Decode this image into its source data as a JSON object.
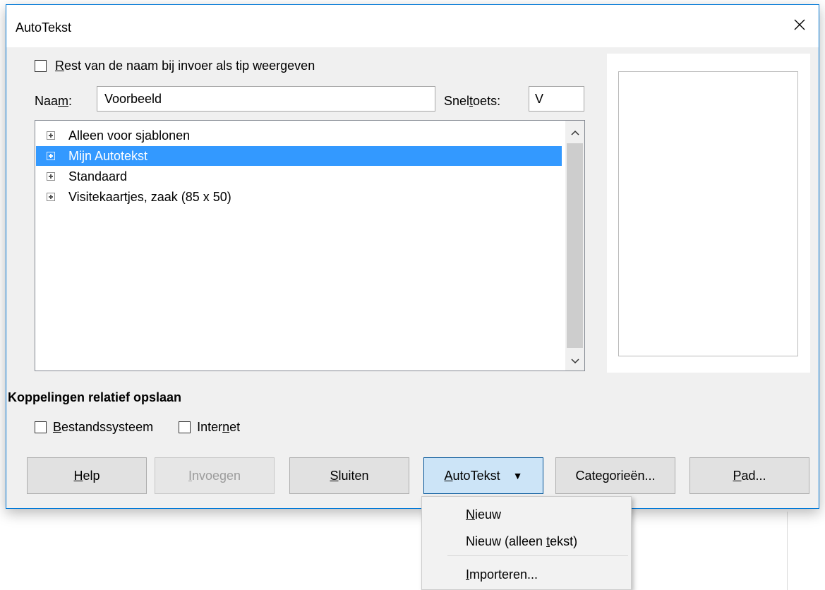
{
  "dialog": {
    "title": "AutoTekst",
    "close_glyph": "✕",
    "tip_checkbox": {
      "label_prefix": "",
      "label_mnemonic": "R",
      "label_rest": "est van de naam bij invoer als tip weergeven",
      "checked": false
    },
    "name_field": {
      "label_prefix": "Naa",
      "label_mnemonic": "m",
      "label_rest": ":",
      "value": "Voorbeeld"
    },
    "shortcut_field": {
      "label_prefix": "Snel",
      "label_mnemonic": "t",
      "label_rest": "oets:",
      "value": "V"
    },
    "categories": [
      {
        "label": "Alleen voor sjablonen",
        "selected": false
      },
      {
        "label": "Mijn Autotekst",
        "selected": true
      },
      {
        "label": "Standaard",
        "selected": false
      },
      {
        "label": "Visitekaartjes, zaak (85 x 50)",
        "selected": false
      }
    ],
    "links_section": {
      "heading": "Koppelingen relatief opslaan",
      "filesystem": {
        "label_prefix": "",
        "label_mnemonic": "B",
        "label_rest": "estandssysteem",
        "checked": false
      },
      "internet": {
        "label_prefix": "Inter",
        "label_mnemonic": "n",
        "label_rest": "et",
        "checked": false
      }
    },
    "buttons": {
      "help": {
        "mnemonic": "H",
        "rest": "elp"
      },
      "insert": {
        "mnemonic": "I",
        "rest": "nvoegen",
        "disabled": true
      },
      "close": {
        "mnemonic": "S",
        "rest": "luiten"
      },
      "autotext": {
        "mnemonic": "A",
        "rest": "utoTekst",
        "arrow": "▼"
      },
      "categories": {
        "prefix": "Cate",
        "mnemonic": "g",
        "rest": "orieën..."
      },
      "path": {
        "mnemonic": "P",
        "rest": "ad..."
      }
    }
  },
  "autotext_menu": {
    "items": [
      {
        "prefix": "",
        "mnemonic": "N",
        "rest": "ieuw"
      },
      {
        "prefix": "Nieuw (alleen ",
        "mnemonic": "t",
        "rest": "ekst)"
      },
      {
        "prefix": "",
        "mnemonic": "I",
        "rest": "mporteren..."
      }
    ]
  },
  "colors": {
    "accent_border": "#0078d7",
    "selection": "#3399ff",
    "dialog_bg": "#f0f0f0"
  }
}
